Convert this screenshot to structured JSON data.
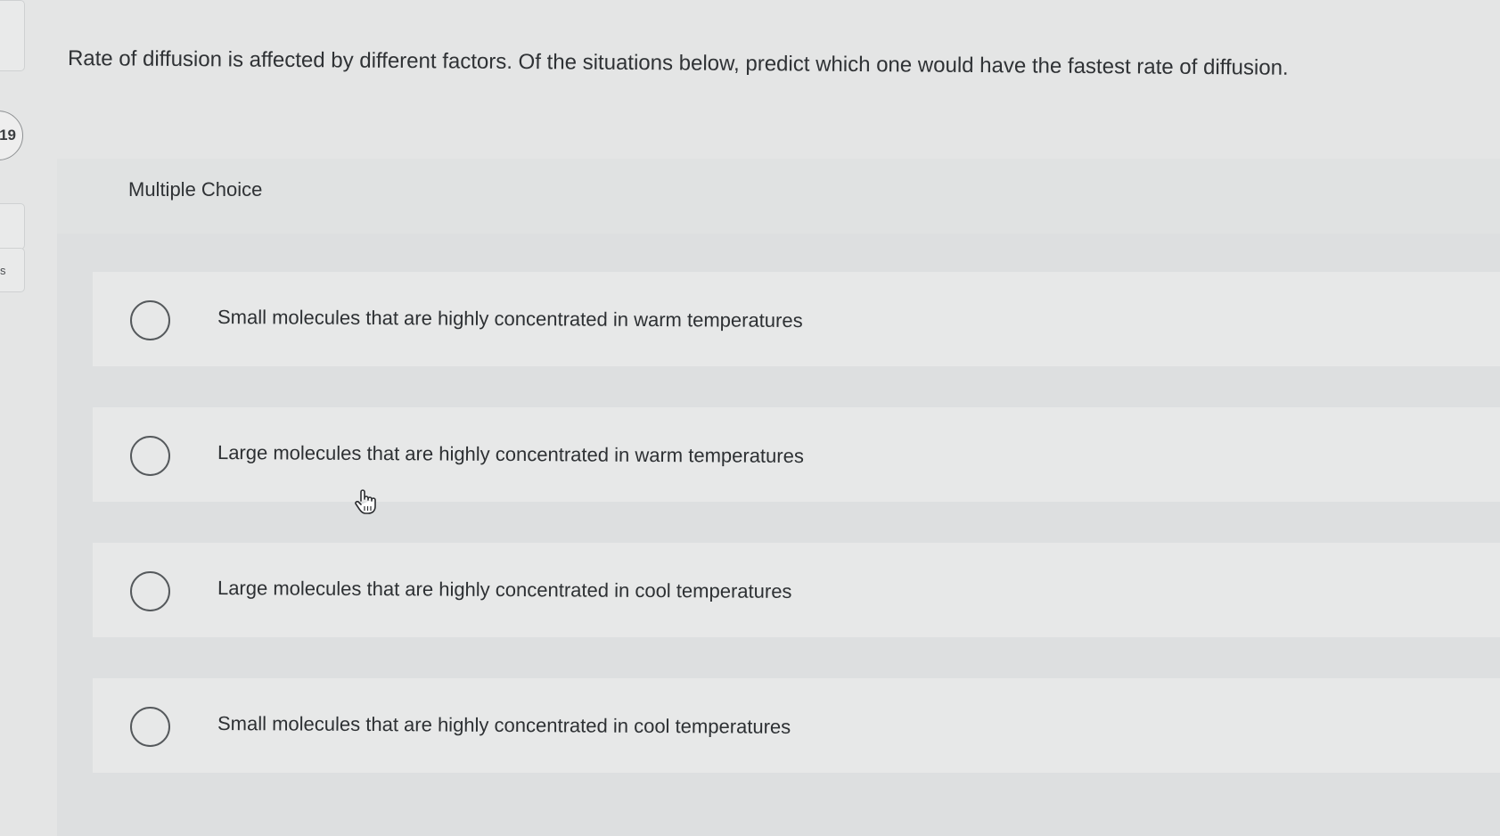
{
  "sidebar": {
    "question_number": "19",
    "letter": "s"
  },
  "question": {
    "text": "Rate of diffusion is affected by different factors. Of the situations below, predict which one would have the fastest rate of diffusion."
  },
  "multiple_choice": {
    "label": "Multiple Choice",
    "options": [
      {
        "label": "Small molecules that are highly concentrated in warm temperatures",
        "selected": false
      },
      {
        "label": "Large molecules that are highly concentrated in warm temperatures",
        "selected": false
      },
      {
        "label": "Large molecules that are highly concentrated in cool temperatures",
        "selected": false
      },
      {
        "label": "Small molecules that are highly concentrated in cool temperatures",
        "selected": false
      }
    ]
  },
  "cursor": {
    "icon": "hand-pointer-icon"
  }
}
